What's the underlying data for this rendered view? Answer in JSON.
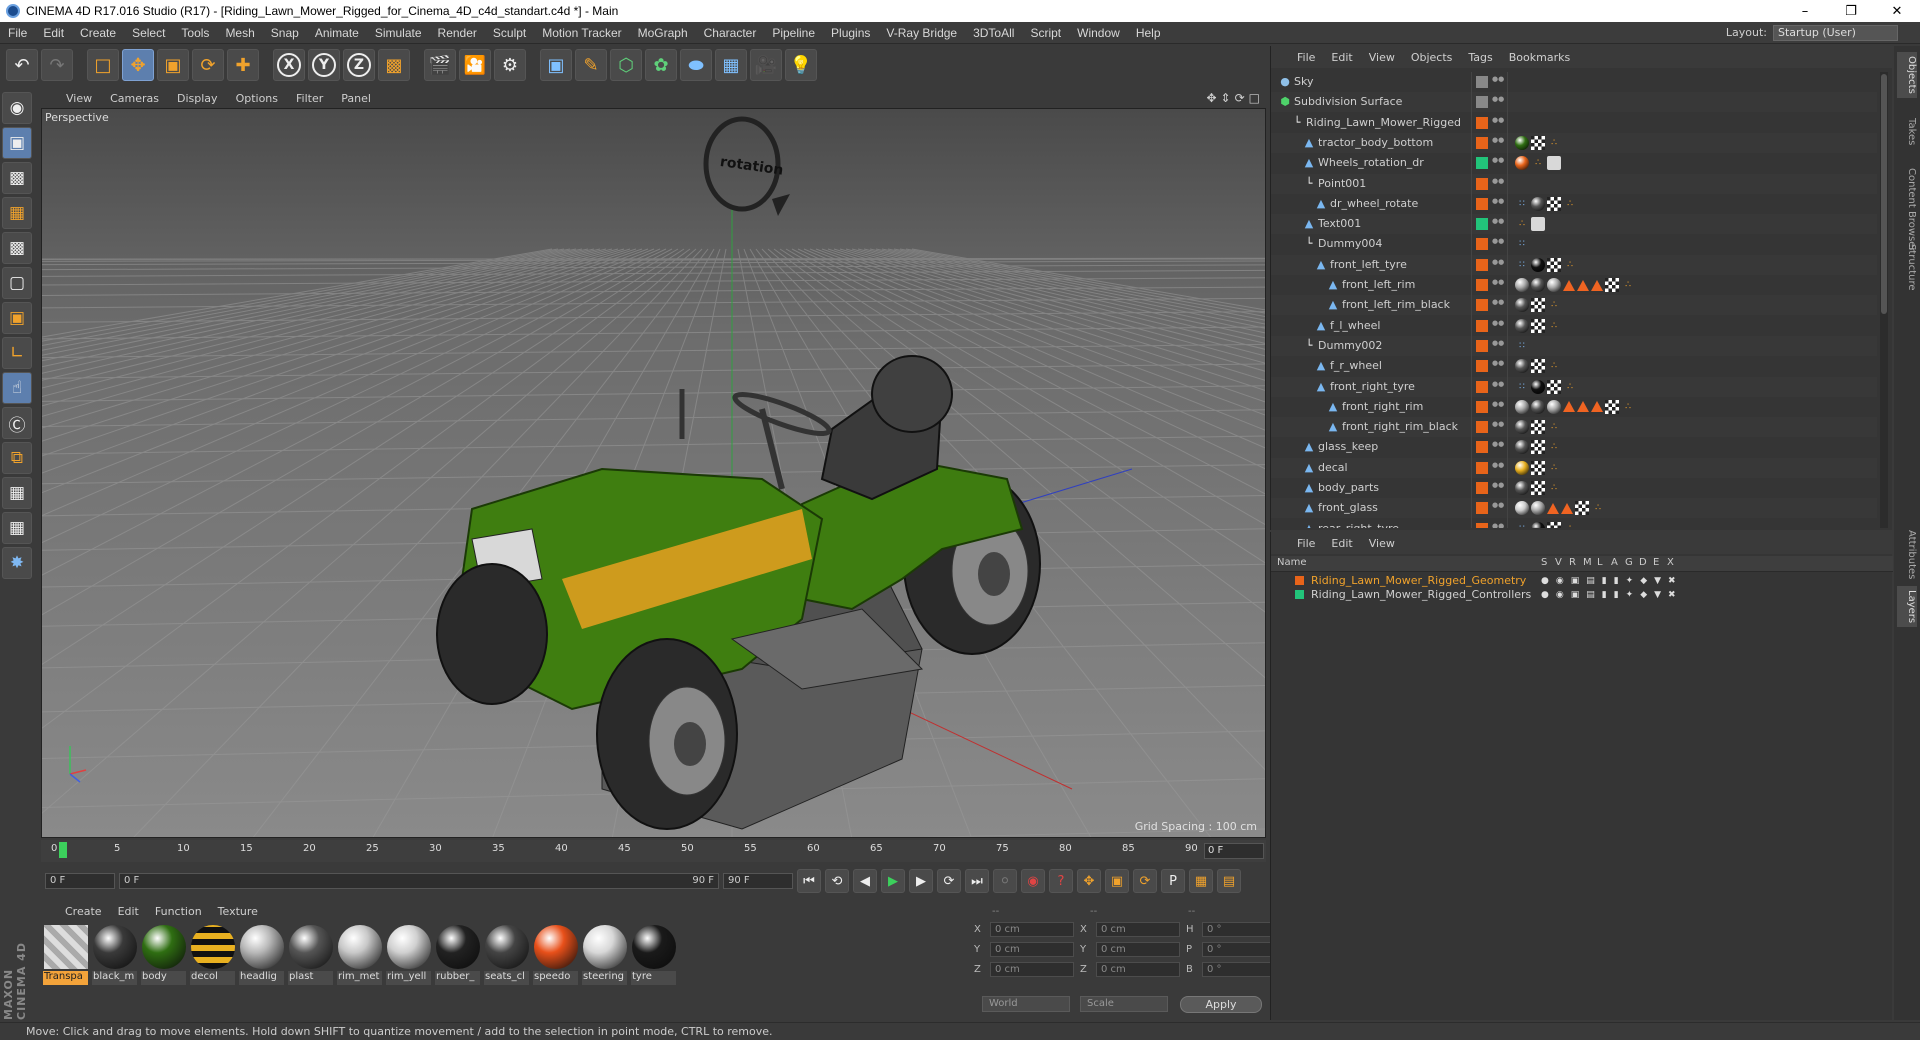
{
  "window": {
    "title": "CINEMA 4D R17.016 Studio (R17) - [Riding_Lawn_Mower_Rigged_for_Cinema_4D_c4d_standart.c4d *] - Main",
    "controls": [
      "–",
      "❐",
      "✕"
    ]
  },
  "menubar": {
    "items": [
      "File",
      "Edit",
      "Create",
      "Select",
      "Tools",
      "Mesh",
      "Snap",
      "Animate",
      "Simulate",
      "Render",
      "Sculpt",
      "Motion Tracker",
      "MoGraph",
      "Character",
      "Pipeline",
      "Plugins",
      "V-Ray Bridge",
      "3DToAll",
      "Script",
      "Window",
      "Help"
    ],
    "layout_label": "Layout:",
    "layout_value": "Startup (User)"
  },
  "viewport": {
    "menu": [
      "View",
      "Cameras",
      "Display",
      "Options",
      "Filter",
      "Panel"
    ],
    "label": "Perspective",
    "grid_spacing": "Grid Spacing : 100 cm",
    "rotation_text": "rotation"
  },
  "timeline": {
    "ticks": [
      "0",
      "5",
      "10",
      "15",
      "20",
      "25",
      "30",
      "35",
      "40",
      "45",
      "50",
      "55",
      "60",
      "65",
      "70",
      "75",
      "80",
      "85",
      "90"
    ],
    "current": "0 F"
  },
  "playbar": {
    "start": "0 F",
    "range_start": "0 F",
    "range_end": "90 F",
    "end": "90 F"
  },
  "material_menu": [
    "Create",
    "Edit",
    "Function",
    "Texture"
  ],
  "materials": [
    {
      "label": "Transpa",
      "color": "#cccccc",
      "selected": true
    },
    {
      "label": "black_m",
      "color": "#3a3a3a"
    },
    {
      "label": "body",
      "color": "#2f6e12"
    },
    {
      "label": "decol",
      "color": "#e8b020"
    },
    {
      "label": "headlig",
      "color": "#b8b8b8"
    },
    {
      "label": "plast",
      "color": "#555555"
    },
    {
      "label": "rim_met",
      "color": "#c8c8c8"
    },
    {
      "label": "rim_yell",
      "color": "#d0d0d0"
    },
    {
      "label": "rubber_",
      "color": "#222222"
    },
    {
      "label": "seats_cl",
      "color": "#444444"
    },
    {
      "label": "speedo",
      "color": "#e8501a"
    },
    {
      "label": "steering",
      "color": "#d8d8d8"
    },
    {
      "label": "tyre",
      "color": "#1a1a1a"
    }
  ],
  "coords": {
    "headers": [
      "--",
      "--",
      "--"
    ],
    "rows": [
      {
        "a": "X",
        "av": "0 cm",
        "b": "X",
        "bv": "0 cm",
        "c": "H",
        "cv": "0 °"
      },
      {
        "a": "Y",
        "av": "0 cm",
        "b": "Y",
        "bv": "0 cm",
        "c": "P",
        "cv": "0 °"
      },
      {
        "a": "Z",
        "av": "0 cm",
        "b": "Z",
        "bv": "0 cm",
        "c": "B",
        "cv": "0 °"
      }
    ],
    "world": "World",
    "scale": "Scale",
    "apply": "Apply"
  },
  "status": "Move: Click and drag to move elements. Hold down SHIFT to quantize movement / add to the selection in point mode, CTRL to remove.",
  "object_manager": {
    "menu": [
      "File",
      "Edit",
      "View",
      "Objects",
      "Tags",
      "Bookmarks"
    ],
    "objects": [
      {
        "name": "Sky",
        "indent": 0,
        "icon": "sky",
        "color": "#888888",
        "tags": []
      },
      {
        "name": "Subdivision Surface",
        "indent": 0,
        "icon": "green",
        "color": "#888888",
        "tags": []
      },
      {
        "name": "Riding_Lawn_Mower_Rigged",
        "indent": 1,
        "icon": "null",
        "color": "#e8641a",
        "tags": []
      },
      {
        "name": "tractor_body_bottom",
        "indent": 2,
        "icon": "poly",
        "color": "#e8641a",
        "tags": [
          "#2f6e12",
          "chk",
          "dots"
        ]
      },
      {
        "name": "Wheels_rotation_dr",
        "indent": 2,
        "icon": "poly",
        "color": "#22c47a",
        "tags": [
          "#e8641a",
          "dots",
          "grey"
        ]
      },
      {
        "name": "Point001",
        "indent": 2,
        "icon": "null",
        "color": "#e8641a",
        "tags": []
      },
      {
        "name": "dr_wheel_rotate",
        "indent": 3,
        "icon": "poly",
        "color": "#e8641a",
        "tags": [
          "blue",
          "#555555",
          "chk",
          "dots"
        ]
      },
      {
        "name": "Text001",
        "indent": 2,
        "icon": "poly",
        "color": "#22c47a",
        "tags": [
          "dots",
          "grey"
        ]
      },
      {
        "name": "Dummy004",
        "indent": 2,
        "icon": "null",
        "color": "#e8641a",
        "tags": [
          "blue"
        ]
      },
      {
        "name": "front_left_tyre",
        "indent": 3,
        "icon": "poly",
        "color": "#e8641a",
        "tags": [
          "blue",
          "#111111",
          "chk",
          "dots"
        ]
      },
      {
        "name": "front_left_rim",
        "indent": 4,
        "icon": "poly",
        "color": "#e8641a",
        "tags": [
          "#aaaaaa",
          "#555555",
          "#aaaaaa",
          "tri",
          "tri",
          "tri",
          "chk",
          "dots"
        ]
      },
      {
        "name": "front_left_rim_black",
        "indent": 4,
        "icon": "poly",
        "color": "#e8641a",
        "tags": [
          "#555555",
          "chk",
          "dots"
        ]
      },
      {
        "name": "f_l_wheel",
        "indent": 3,
        "icon": "poly",
        "color": "#e8641a",
        "tags": [
          "#555555",
          "chk",
          "dots"
        ]
      },
      {
        "name": "Dummy002",
        "indent": 2,
        "icon": "null",
        "color": "#e8641a",
        "tags": [
          "blue"
        ]
      },
      {
        "name": "f_r_wheel",
        "indent": 3,
        "icon": "poly",
        "color": "#e8641a",
        "tags": [
          "#555555",
          "chk",
          "dots"
        ]
      },
      {
        "name": "front_right_tyre",
        "indent": 3,
        "icon": "poly",
        "color": "#e8641a",
        "tags": [
          "blue",
          "#111111",
          "chk",
          "dots"
        ]
      },
      {
        "name": "front_right_rim",
        "indent": 4,
        "icon": "poly",
        "color": "#e8641a",
        "tags": [
          "#aaaaaa",
          "#555555",
          "#aaaaaa",
          "tri",
          "tri",
          "tri",
          "chk",
          "dots"
        ]
      },
      {
        "name": "front_right_rim_black",
        "indent": 4,
        "icon": "poly",
        "color": "#e8641a",
        "tags": [
          "#555555",
          "chk",
          "dots"
        ]
      },
      {
        "name": "glass_keep",
        "indent": 2,
        "icon": "poly",
        "color": "#e8641a",
        "tags": [
          "#555555",
          "chk",
          "dots"
        ]
      },
      {
        "name": "decal",
        "indent": 2,
        "icon": "poly",
        "color": "#e8641a",
        "tags": [
          "#e8b020",
          "chk",
          "dots"
        ]
      },
      {
        "name": "body_parts",
        "indent": 2,
        "icon": "poly",
        "color": "#e8641a",
        "tags": [
          "#555555",
          "chk",
          "dots"
        ]
      },
      {
        "name": "front_glass",
        "indent": 2,
        "icon": "poly",
        "color": "#e8641a",
        "tags": [
          "#cccccc",
          "#aaaaaa",
          "tri",
          "tri",
          "chk",
          "dots"
        ]
      },
      {
        "name": "rear_right_tyre",
        "indent": 2,
        "icon": "poly",
        "color": "#e8641a",
        "tags": [
          "blue",
          "#111111",
          "chk",
          "dots"
        ]
      }
    ]
  },
  "layer_manager": {
    "menu": [
      "File",
      "Edit",
      "View"
    ],
    "head_name": "Name",
    "head_cols": [
      "S",
      "V",
      "R",
      "M",
      "L",
      "A",
      "G",
      "D",
      "E",
      "X"
    ],
    "layers": [
      {
        "name": "Riding_Lawn_Mower_Rigged_Geometry",
        "color": "#e8641a",
        "text_color": "#f0a22c"
      },
      {
        "name": "Riding_Lawn_Mower_Rigged_Controllers",
        "color": "#22c47a",
        "text_color": "#cfcfcf"
      }
    ]
  },
  "side_tabs": [
    "Objects",
    "Takes",
    "Content Browser",
    "Structure",
    "Attributes",
    "Layers"
  ]
}
